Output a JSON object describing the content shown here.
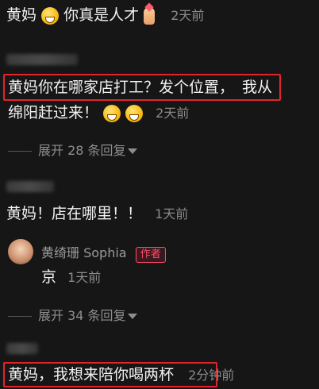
{
  "comments": [
    {
      "text_a": "黄妈",
      "text_b": "你真是人才",
      "time": "2天前"
    },
    {
      "text_highlight": "黄妈你在哪家店打工？发个位置，",
      "text_rest_line1": "我从",
      "text_line2": "绵阳赶过来！",
      "time": "2天前",
      "expand": "展开 28 条回复"
    },
    {
      "text": "黄妈！店在哪里！！",
      "time": "1天前"
    },
    {
      "author": "黄绮珊 Sophia",
      "badge": "作者",
      "text": "京",
      "time": "1天前",
      "expand": "展开 34 条回复"
    },
    {
      "text": "黄妈，我想来陪你喝两杯",
      "time": "2分钟前"
    }
  ],
  "colors": {
    "background": "#161616",
    "highlight_box": "#e0242c",
    "author_tag": "#ff4d67"
  }
}
